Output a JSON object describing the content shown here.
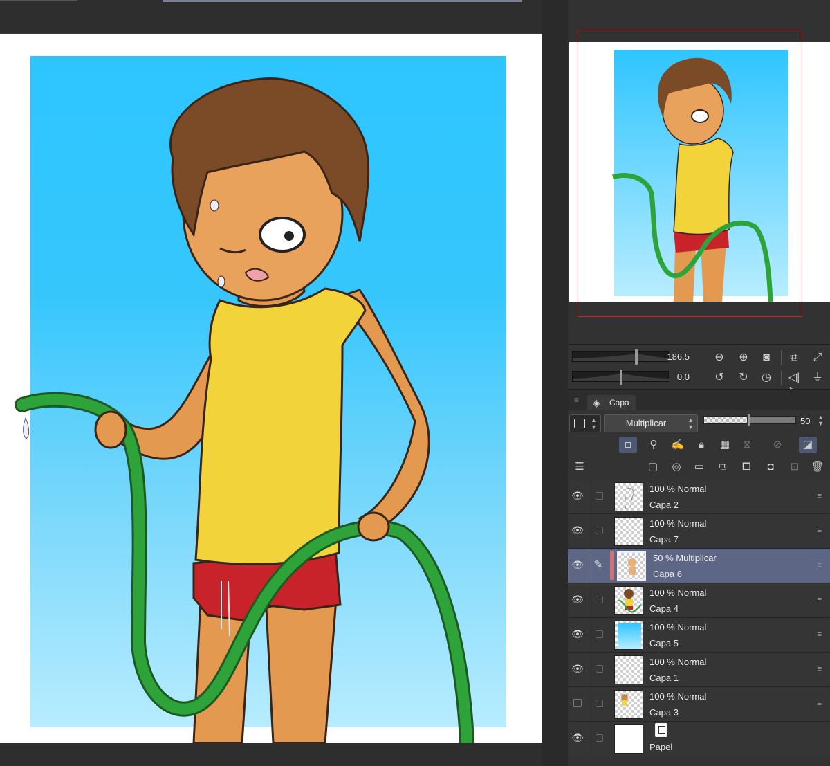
{
  "navigator": {
    "zoom_value": "186.5",
    "rotation_value": "0.0"
  },
  "layer_panel": {
    "tab_label": "Capa",
    "blend_mode": "Multiplicar",
    "opacity_value": "50",
    "layers": [
      {
        "mode": "100 %  Normal",
        "name": "Capa 2",
        "visible": true,
        "selected": false
      },
      {
        "mode": "100 %  Normal",
        "name": "Capa 7",
        "visible": true,
        "selected": false
      },
      {
        "mode": "50 %  Multiplicar",
        "name": "Capa 6",
        "visible": true,
        "selected": true
      },
      {
        "mode": "100 %  Normal",
        "name": "Capa 4",
        "visible": true,
        "selected": false
      },
      {
        "mode": "100 %  Normal",
        "name": "Capa 5",
        "visible": true,
        "selected": false
      },
      {
        "mode": "100 %  Normal",
        "name": "Capa 1",
        "visible": true,
        "selected": false
      },
      {
        "mode": "100 %  Normal",
        "name": "Capa 3",
        "visible": false,
        "selected": false
      },
      {
        "mode": "",
        "name": "Papel",
        "visible": true,
        "selected": false
      }
    ]
  },
  "colors": {
    "sky_top": "#2ec5ff",
    "sky_bottom": "#b4ebff",
    "shirt": "#f2d43a",
    "shorts": "#c8232b",
    "hose": "#2ea33a",
    "hair": "#7a4b26",
    "skin": "#e8a25c",
    "selection_highlight": "#5d6684",
    "navigator_frame": "#d81e1e"
  }
}
